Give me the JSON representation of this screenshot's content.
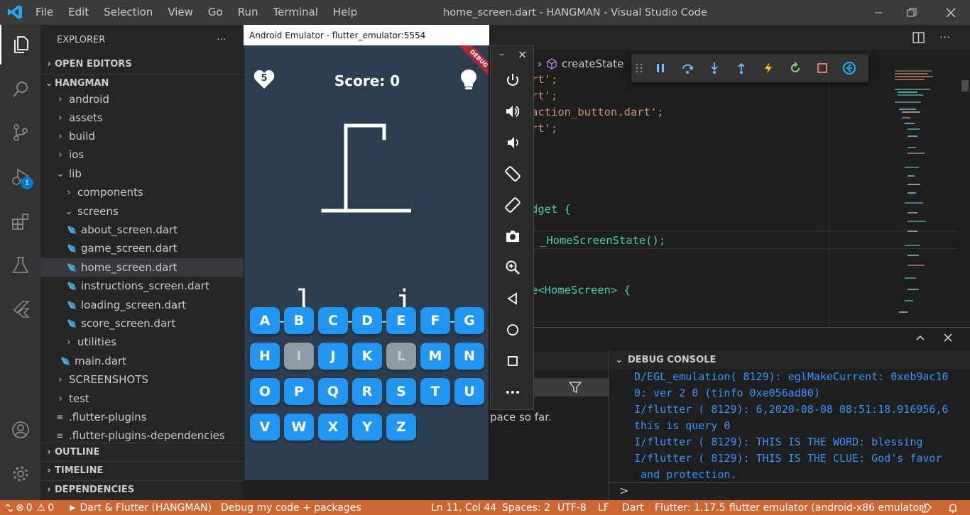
{
  "titlebar": {
    "menu": [
      "File",
      "Edit",
      "Selection",
      "View",
      "Go",
      "Run",
      "Terminal",
      "Help"
    ],
    "title": "home_screen.dart - HANGMAN - Visual Studio Code"
  },
  "activitybar": {
    "debug_badge": "1"
  },
  "explorer": {
    "header": "EXPLORER",
    "more": "···",
    "open_editors": "OPEN EDITORS",
    "project": "HANGMAN",
    "items": [
      {
        "label": "android"
      },
      {
        "label": "assets"
      },
      {
        "label": "build"
      },
      {
        "label": "ios"
      },
      {
        "label": "lib"
      },
      {
        "label": "components"
      },
      {
        "label": "screens"
      },
      {
        "label": "about_screen.dart"
      },
      {
        "label": "game_screen.dart"
      },
      {
        "label": "home_screen.dart"
      },
      {
        "label": "instructions_screen.dart"
      },
      {
        "label": "loading_screen.dart"
      },
      {
        "label": "score_screen.dart"
      },
      {
        "label": "utilities"
      },
      {
        "label": "main.dart"
      },
      {
        "label": "SCREENSHOTS"
      },
      {
        "label": "test"
      },
      {
        "label": ".flutter-plugins"
      },
      {
        "label": ".flutter-plugins-dependencies"
      }
    ],
    "outline": "OUTLINE",
    "timeline": "TIMELINE",
    "dependencies": "DEPENDENCIES"
  },
  "editor": {
    "breadcrumb": "createState",
    "lines": [
      "rt';",
      "rt';",
      "action_button.dart';",
      "rt';",
      "dget {",
      "_HomeScreenState();",
      "e<HomeScreen> {"
    ]
  },
  "panel": {
    "filter_text": "pace so far.",
    "debug_console_title": "DEBUG CONSOLE",
    "console_lines": [
      "D/EGL_emulation( 8129): eglMakeCurrent: 0xeb9ac10",
      "0: ver 2 0 (tinfo 0xe056ad80)",
      "I/flutter ( 8129): 6,2020-08-08 08:51:18.916956,6",
      "this is query 0",
      "I/flutter ( 8129): THIS IS THE WORD: blessing",
      "I/flutter ( 8129): THIS IS THE CLUE: God's favor",
      " and protection."
    ],
    "prompt": ">"
  },
  "emulator": {
    "title": "Android Emulator - flutter_emulator:5554",
    "debug_banner": "DEBUG",
    "lives": "5",
    "score": "Score: 0",
    "word_blanks": [
      "_",
      "l",
      "_",
      "_",
      "_",
      "i",
      "_",
      "_"
    ],
    "keys": [
      {
        "label": "A",
        "disabled": false
      },
      {
        "label": "B",
        "disabled": false
      },
      {
        "label": "C",
        "disabled": false
      },
      {
        "label": "D",
        "disabled": false
      },
      {
        "label": "E",
        "disabled": false
      },
      {
        "label": "F",
        "disabled": false
      },
      {
        "label": "G",
        "disabled": false
      },
      {
        "label": "H",
        "disabled": false
      },
      {
        "label": "I",
        "disabled": true
      },
      {
        "label": "J",
        "disabled": false
      },
      {
        "label": "K",
        "disabled": false
      },
      {
        "label": "L",
        "disabled": true
      },
      {
        "label": "M",
        "disabled": false
      },
      {
        "label": "N",
        "disabled": false
      },
      {
        "label": "O",
        "disabled": false
      },
      {
        "label": "P",
        "disabled": false
      },
      {
        "label": "Q",
        "disabled": false
      },
      {
        "label": "R",
        "disabled": false
      },
      {
        "label": "S",
        "disabled": false
      },
      {
        "label": "T",
        "disabled": false
      },
      {
        "label": "U",
        "disabled": false
      },
      {
        "label": "V",
        "disabled": false
      },
      {
        "label": "W",
        "disabled": false
      },
      {
        "label": "X",
        "disabled": false
      },
      {
        "label": "Y",
        "disabled": false
      },
      {
        "label": "Z",
        "disabled": false
      }
    ],
    "side_controls": [
      "power-icon",
      "volume-up-icon",
      "volume-down-icon",
      "rotate-left-icon",
      "rotate-right-icon",
      "camera-icon",
      "zoom-icon",
      "back-icon",
      "home-icon",
      "overview-icon",
      "more-icon"
    ],
    "side_min": "–",
    "side_close": "×"
  },
  "statusbar": {
    "errors": "0",
    "warnings": "0",
    "launch": "Dart & Flutter (HANGMAN)",
    "debug_mode": "Debug my code + packages",
    "cursor": "Ln 11, Col 44",
    "spaces": "Spaces: 2",
    "encoding": "UTF-8",
    "eol": "LF",
    "language": "Dart",
    "flutter": "Flutter: 1.17.5",
    "device": "flutter emulator (android-x86 emulator)"
  },
  "colors": {
    "statusbar": "#cc6633",
    "accent": "#007acc",
    "key": "#2196f3",
    "phone_bg": "#2c3e50"
  }
}
